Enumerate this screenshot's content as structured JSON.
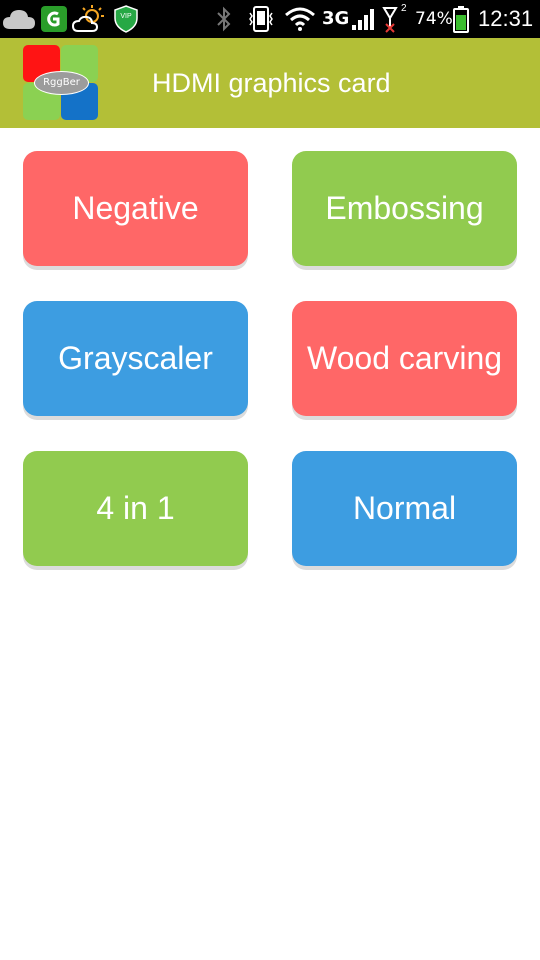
{
  "status_bar": {
    "battery_percent": "74%",
    "time": "12:31",
    "network": "3G",
    "sim_indicator": "2",
    "vip_label": "VIP",
    "icons": [
      "cloud-icon",
      "notification-app-icon",
      "weather-sun-icon",
      "vip-shield-icon",
      "bluetooth-icon",
      "vibrate-icon",
      "wifi-icon",
      "signal-icon",
      "sim2-signal-icon",
      "battery-icon"
    ]
  },
  "app_bar": {
    "title": "HDMI graphics card",
    "logo_text": "RggBer",
    "background": "#b3bf37"
  },
  "buttons": [
    {
      "label": "Negative",
      "color": "#ff6767"
    },
    {
      "label": "Embossing",
      "color": "#91cb4f"
    },
    {
      "label": "Grayscaler",
      "color": "#3d9de1"
    },
    {
      "label": "Wood carving",
      "color": "#ff6767"
    },
    {
      "label": "4 in 1",
      "color": "#91cb4f"
    },
    {
      "label": "Normal",
      "color": "#3d9de1"
    }
  ]
}
